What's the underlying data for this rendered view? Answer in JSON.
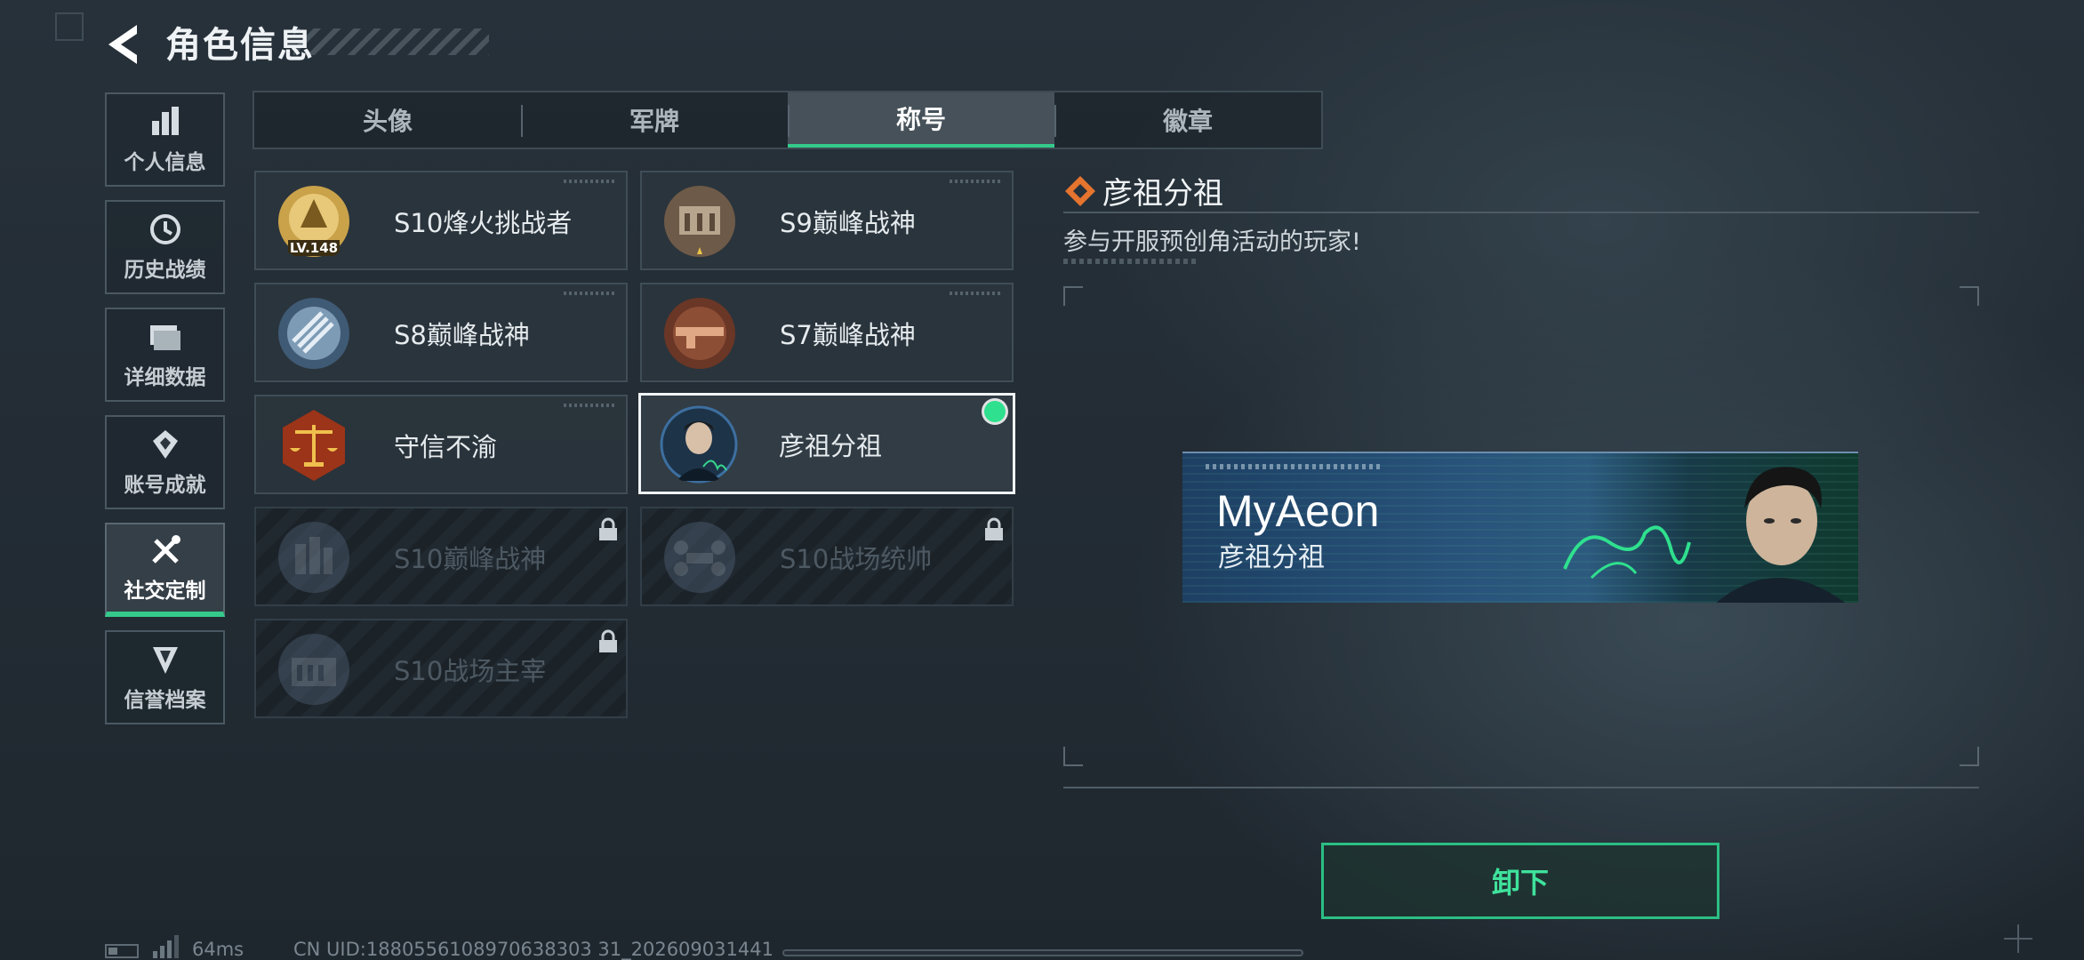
{
  "header": {
    "title": "角色信息"
  },
  "sidebar": {
    "items": [
      {
        "label": "个人信息",
        "icon": "bar-chart-icon"
      },
      {
        "label": "历史战绩",
        "icon": "history-clock-icon"
      },
      {
        "label": "详细数据",
        "icon": "folder-icon"
      },
      {
        "label": "账号成就",
        "icon": "achievement-icon"
      },
      {
        "label": "社交定制",
        "icon": "tools-icon",
        "active": true
      },
      {
        "label": "信誉档案",
        "icon": "reputation-icon"
      }
    ]
  },
  "tabs": [
    {
      "label": "头像"
    },
    {
      "label": "军牌"
    },
    {
      "label": "称号",
      "active": true
    },
    {
      "label": "徽章"
    }
  ],
  "titles": [
    {
      "name": "S10烽火挑战者",
      "badge_text": "LV.148",
      "locked": false
    },
    {
      "name": "S9巅峰战神",
      "locked": false
    },
    {
      "name": "S8巅峰战神",
      "locked": false
    },
    {
      "name": "S7巅峰战神",
      "locked": false
    },
    {
      "name": "守信不渝",
      "locked": false
    },
    {
      "name": "彦祖分祖",
      "locked": false,
      "selected": true,
      "equipped": true
    },
    {
      "name": "S10巅峰战神",
      "locked": true
    },
    {
      "name": "S10战场统帅",
      "locked": true
    },
    {
      "name": "S10战场主宰",
      "locked": true
    }
  ],
  "detail": {
    "title": "彦祖分祖",
    "description": "参与开服预创角活动的玩家!"
  },
  "banner": {
    "player_name": "MyAeon",
    "title": "彦祖分祖"
  },
  "actions": {
    "unequip_label": "卸下"
  },
  "status": {
    "ping": "64ms",
    "uid": "CN UID:1880556108970638303 31_202609031441"
  },
  "colors": {
    "accent": "#35c98b",
    "equipped_dot": "#2fe08e",
    "background": "#242e36"
  }
}
